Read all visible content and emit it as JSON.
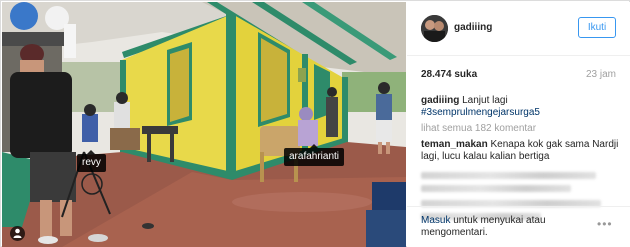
{
  "photo": {
    "tags": [
      "revy",
      "arafahrianti"
    ],
    "person_icon": "user-tag-icon"
  },
  "post": {
    "username": "gadiiing",
    "follow_label": "Ikuti",
    "likes": "28.474 suka",
    "time": "23 jam"
  },
  "caption": {
    "user": "gadiiing",
    "text": "Lanjut lagi",
    "hashtag": "#3semprulmengejarsurga5"
  },
  "view_all": "lihat semua 182 komentar",
  "comment": {
    "user": "teman_makan",
    "text": "Kenapa kok gak sama Nardji lagi, lucu kalau kalian bertiga"
  },
  "footer": {
    "login_link": "Masuk",
    "login_rest": "untuk menyukai atau mengomentari.",
    "more": "•••"
  }
}
